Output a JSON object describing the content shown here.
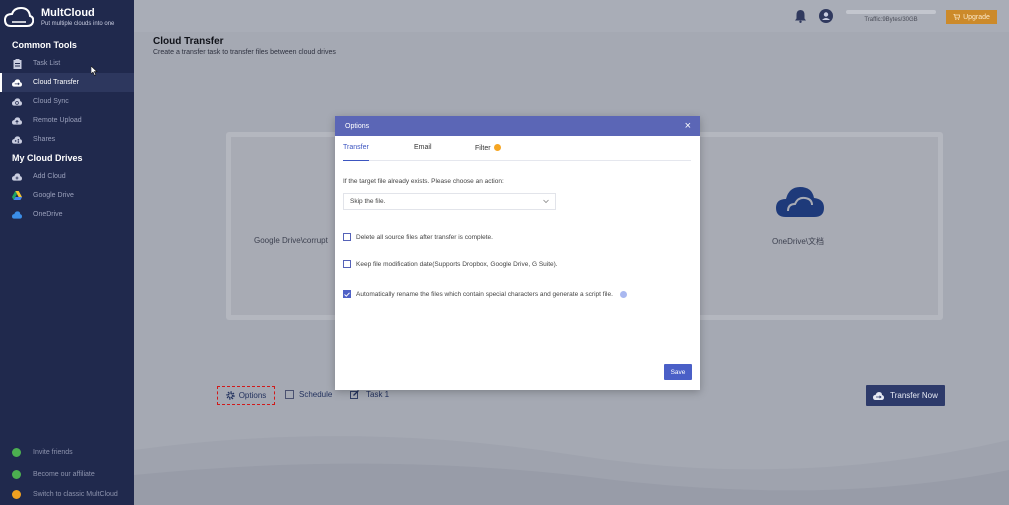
{
  "app": {
    "name": "MultCloud",
    "tagline": "Put multiple clouds into one"
  },
  "sidebar": {
    "common_tools_title": "Common Tools",
    "common_tools": [
      {
        "label": "Task List",
        "icon": "clipboard-icon"
      },
      {
        "label": "Cloud Transfer",
        "icon": "cloud-transfer-icon",
        "active": true
      },
      {
        "label": "Cloud Sync",
        "icon": "cloud-sync-icon"
      },
      {
        "label": "Remote Upload",
        "icon": "cloud-upload-icon"
      },
      {
        "label": "Shares",
        "icon": "share-icon"
      }
    ],
    "drives_title": "My Cloud Drives",
    "drives": [
      {
        "label": "Add Cloud",
        "icon": "add-cloud-icon"
      },
      {
        "label": "Google Drive",
        "icon": "google-drive-icon"
      },
      {
        "label": "OneDrive",
        "icon": "onedrive-icon"
      }
    ],
    "bottom": [
      {
        "label": "Invite friends",
        "icon": "trophy-icon",
        "color": "#4caf50"
      },
      {
        "label": "Become our affiliate",
        "icon": "affiliate-icon",
        "color": "#4caf50"
      },
      {
        "label": "Switch to classic MultCloud",
        "icon": "switch-icon",
        "color": "#f0a020"
      }
    ]
  },
  "topbar": {
    "traffic": "Traffic:9Bytes/30GB",
    "upgrade": "Upgrade"
  },
  "main": {
    "title": "Cloud Transfer",
    "subtitle": "Create a transfer task to transfer files between cloud drives",
    "source": "Google Drive\\corrupt",
    "target": "OneDrive\\文档",
    "options": "Options",
    "schedule": "Schedule",
    "task": "Task 1",
    "transfer_now": "Transfer Now"
  },
  "modal": {
    "title": "Options",
    "tabs": [
      "Transfer",
      "Email",
      "Filter"
    ],
    "active_tab": "Transfer",
    "exists_label": "If the target file already exists. Please choose an action:",
    "exists_value": "Skip the file.",
    "checks": [
      {
        "label": "Delete all source files after transfer is complete.",
        "checked": false
      },
      {
        "label": "Keep file modification date(Supports Dropbox, Google Drive, G Suite).",
        "checked": false
      },
      {
        "label": "Automatically rename the files which contain special characters and generate a script file.",
        "checked": true
      }
    ],
    "save": "Save"
  },
  "colors": {
    "sidebar": "#20294d",
    "modal_header": "#5b66b6",
    "accent": "#4a5fc7",
    "upgrade": "#cc8a2a"
  }
}
